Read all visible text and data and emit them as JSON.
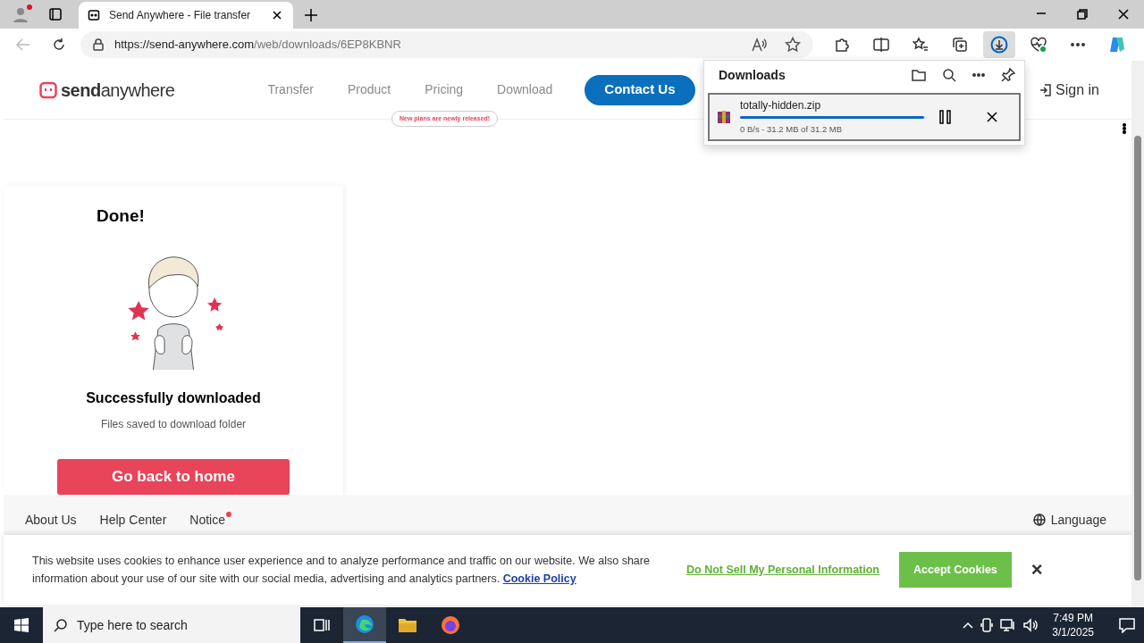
{
  "browser": {
    "tabs": [
      {
        "title": "Send Anywhere - File transfer",
        "selected": true
      }
    ],
    "url_host": "https://send-anywhere.com",
    "url_path": "/web/downloads/6EP8KBNR"
  },
  "site_header": {
    "logo": "**send**anywhere",
    "nav": [
      {
        "label": "Transfer"
      },
      {
        "label": "Product"
      },
      {
        "label": "Pricing"
      },
      {
        "label": "Download"
      }
    ],
    "pricing_note": "New plans are newly released!",
    "contact_button": "Contact Us",
    "sign_in": "Sign in"
  },
  "downloads_panel": {
    "title": "Downloads",
    "items": [
      {
        "name": "totally-hidden.zip",
        "status": "0 B/s - 31.2 MB of 31.2 MB",
        "level": 0.98
      }
    ]
  },
  "result_card": {
    "heading": "Done!",
    "title": "Successfully downloaded",
    "subtitle": "Files saved to download folder",
    "button": "Go back to home"
  },
  "footer": {
    "links": [
      {
        "label": "About Us",
        "dot": false
      },
      {
        "label": "Help Center",
        "dot": false
      },
      {
        "label": "Notice",
        "dot": true
      }
    ],
    "language": "Language"
  },
  "cookie_banner": {
    "text": "This website uses cookies to enhance user experience and to analyze performance and traffic on our website. We also share information about your use of our site with our social media, advertising and analytics partners.",
    "policy_link": "Cookie Policy",
    "do_not_sell": "Do Not Sell My Personal Information",
    "accept": "Accept Cookies",
    "close": "×"
  },
  "taskbar": {
    "search_placeholder": "Type here to search",
    "time": "7:49 PM",
    "date": "3/1/2025"
  }
}
